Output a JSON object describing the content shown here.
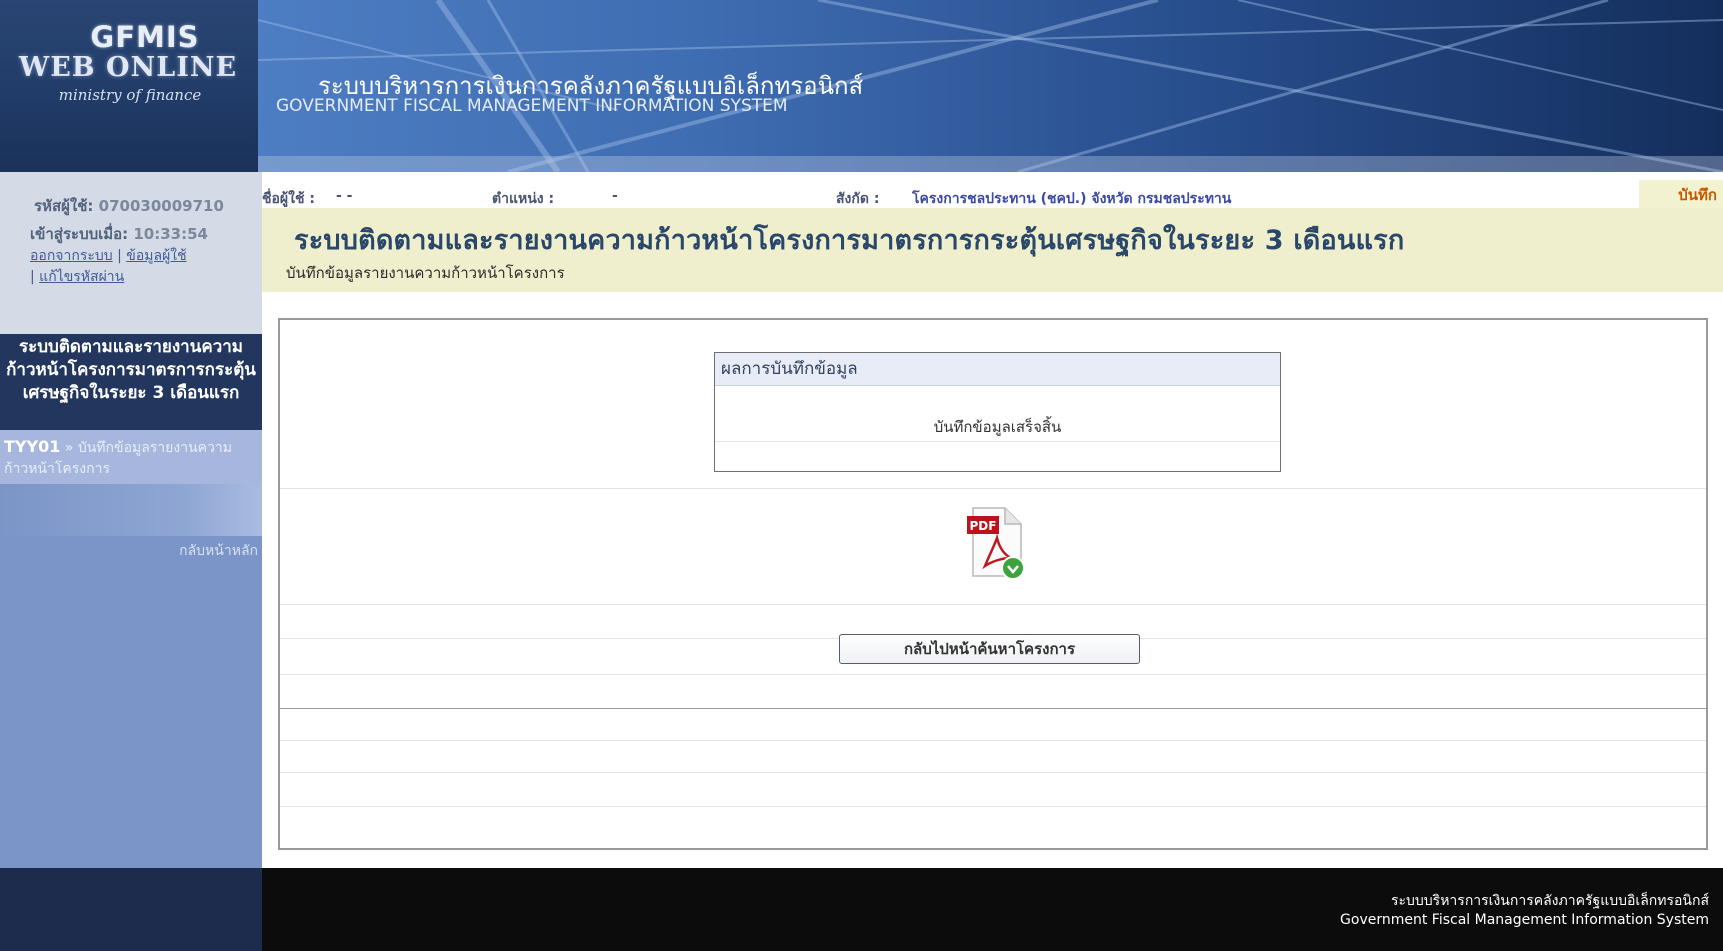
{
  "header": {
    "logo": {
      "line1": "GFMIS",
      "line2": "WEB ONLINE",
      "line3": "ministry of finance"
    },
    "system_name_th": "ระบบบริหารการเงินการคลังภาครัฐแบบอิเล็กทรอนิกส์",
    "system_name_en": "GOVERNMENT FISCAL MANAGEMENT INFORMATION SYSTEM"
  },
  "sidebar": {
    "user_code_label": "รหัสผู้ใช้:",
    "user_code": "070030009710",
    "login_label": "เข้าสู่ระบบเมื่อ:",
    "login_time": "10:33:54",
    "links": {
      "logout": "ออกจากระบบ",
      "user_info": "ข้อมูลผู้ใช้",
      "change_password": "แก้ไขรหัสผ่าน",
      "separator": "|"
    },
    "menu_title": "ระบบติดตามและรายงานความก้าวหน้าโครงการมาตรการกระตุ้นเศรษฐกิจในระยะ 3 เดือนแรก",
    "menu_item": {
      "code": "TYY01",
      "arrow": "»",
      "label": "บันทึกข้อมูลรายงานความก้าวหน้าโครงการ"
    },
    "home_link": "กลับหน้าหลัก"
  },
  "info_bar": {
    "user_label": "ชื่อผู้ใช้ :",
    "user_value": "- -",
    "position_label": "ตำแหน่ง :",
    "position_value": "-",
    "affiliation_label": "สังกัด :",
    "affiliation_value": "โครงการชลประทาน (ชคป.) จังหวัด กรมชลประทาน",
    "tab": "บันทึก"
  },
  "page": {
    "title": "ระบบติดตามและรายงานความก้าวหน้าโครงการมาตรการกระตุ้นเศรษฐกิจในระยะ 3 เดือนแรก",
    "subtitle": "บันทึกข้อมูลรายงานความก้าวหน้าโครงการ"
  },
  "result": {
    "header": "ผลการบันทึกข้อมูล",
    "message": "บันทึกข้อมูลเสร็จสิ้น"
  },
  "pdf": {
    "badge": "PDF",
    "icon": "pdf-download-icon"
  },
  "actions": {
    "back_label": "กลับไปหน้าค้นหาโครงการ"
  },
  "footer": {
    "line_th": "ระบบบริหารการเงินการคลังภาครัฐแบบอิเล็กทรอนิกส์",
    "line_en": "Government Fiscal Management Information System"
  },
  "colors": {
    "header_dark": "#132a54",
    "sidebar": "#7b95c8",
    "menu_dark": "#23375e",
    "title_band": "#efefcd",
    "title_text": "#29476b",
    "tab_text": "#c35a00",
    "pdf_red": "#b8141c",
    "download_green": "#3ea33e"
  }
}
